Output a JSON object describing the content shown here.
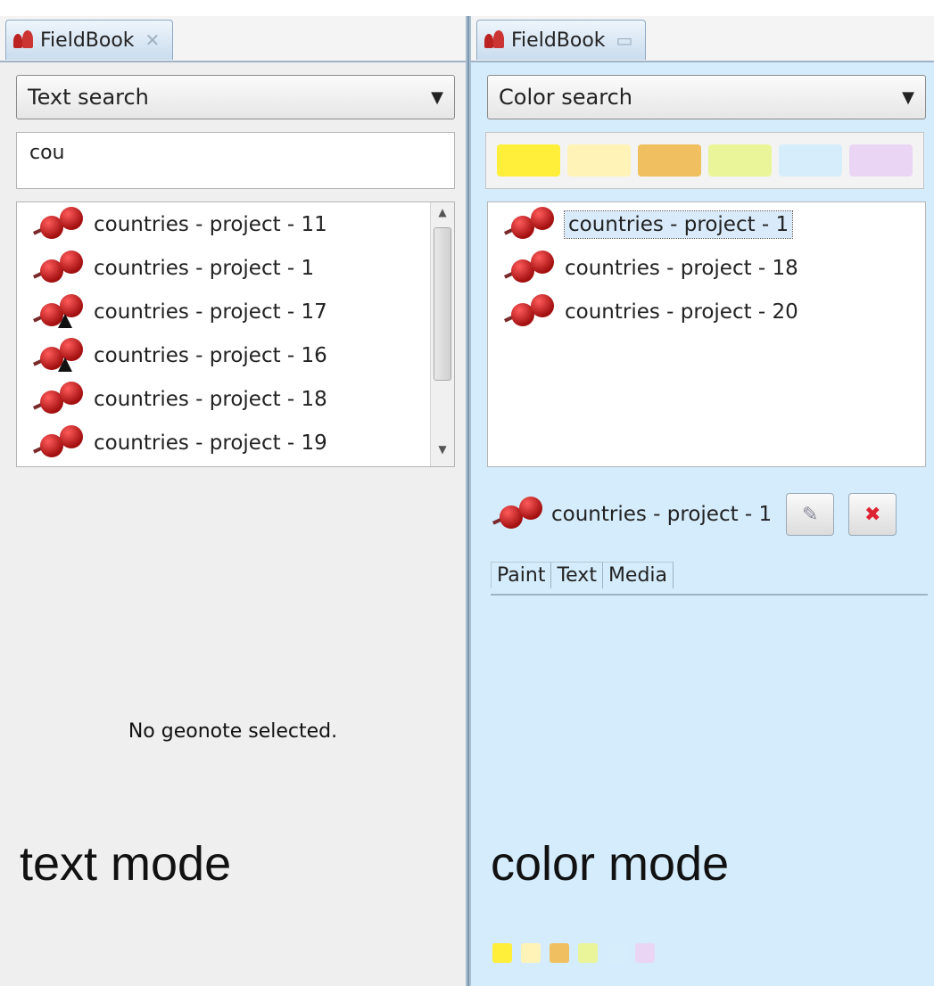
{
  "left": {
    "tab": {
      "title": "FieldBook"
    },
    "search_mode": "Text search",
    "search_value": "cou",
    "items": [
      {
        "label": "countries - project - 11",
        "marker": false
      },
      {
        "label": "countries - project - 1",
        "marker": false
      },
      {
        "label": "countries - project - 17",
        "marker": true
      },
      {
        "label": "countries - project - 16",
        "marker": true
      },
      {
        "label": "countries - project - 18",
        "marker": false
      },
      {
        "label": "countries - project - 19",
        "marker": false
      }
    ],
    "empty_message": "No geonote selected.",
    "mode_caption": "text mode"
  },
  "right": {
    "tab": {
      "title": "FieldBook"
    },
    "search_mode": "Color search",
    "swatches": [
      "#ffef3a",
      "#fff3b8",
      "#f0c060",
      "#eaf59a",
      "#d6eefc",
      "#ead6f4"
    ],
    "items": [
      {
        "label": "countries - project - 1",
        "selected": true
      },
      {
        "label": "countries - project - 18",
        "selected": false
      },
      {
        "label": "countries - project - 20",
        "selected": false
      }
    ],
    "detail": {
      "title": "countries - project - 1",
      "tabs": [
        "Paint",
        "Text",
        "Media"
      ]
    },
    "mode_caption": "color mode",
    "mini_swatches": [
      "#ffef3a",
      "#fff3b8",
      "#f0c060",
      "#eaf59a",
      "#d6eefc",
      "#ead6f4"
    ]
  }
}
